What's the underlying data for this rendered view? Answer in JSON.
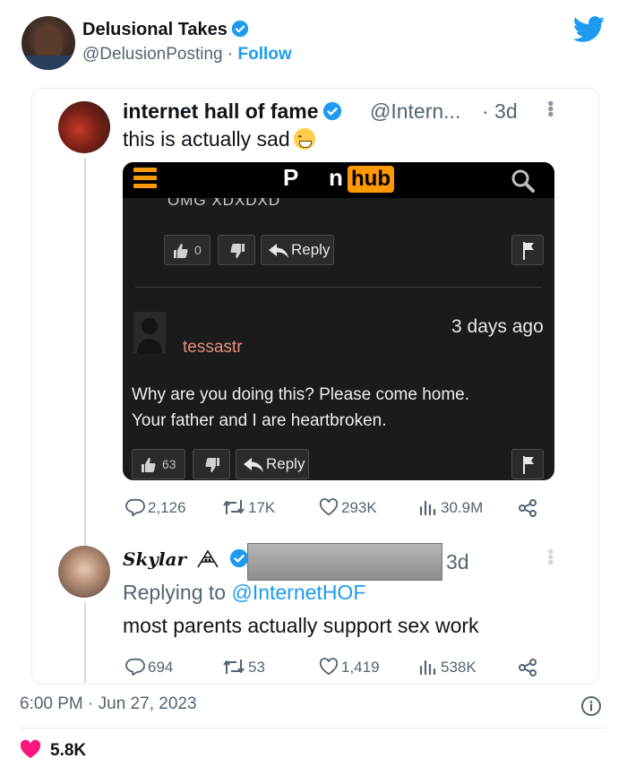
{
  "outer": {
    "name": "Delusional Takes",
    "handle": "@DelusionPosting",
    "separator": "·",
    "follow_label": "Follow"
  },
  "quoted": {
    "name": "internet hall of fame",
    "handle": "@Intern...",
    "time": "· 3d",
    "text": "this is actually sad",
    "screenshot": {
      "logo_left": "P",
      "logo_n": "n",
      "logo_hub": "hub",
      "truncated_text": "OMG XDXDXD",
      "vote_up_count_1": "0",
      "reply_label_1": "Reply",
      "commenter": "tessastr",
      "time_ago": "3 days ago",
      "comment_line_1": "Why are you doing this? Please come home.",
      "comment_line_2": "Your father and I are heartbroken.",
      "vote_up_count_2": "63",
      "reply_label_2": "Reply"
    },
    "metrics": {
      "replies": "2,126",
      "retweets": "17K",
      "likes": "293K",
      "views": "30.9M"
    }
  },
  "reply": {
    "name": "Skylar",
    "time": "3d",
    "replying_prefix": "Replying to",
    "replying_mention": "@InternetHOF",
    "text": "most parents actually support sex work",
    "metrics": {
      "replies": "694",
      "retweets": "53",
      "likes": "1,419",
      "views": "538K"
    }
  },
  "footer": {
    "timestamp": "6:00 PM · Jun 27, 2023",
    "likes": "5.8K"
  },
  "colors": {
    "accent": "#1d9bf0",
    "muted": "#536471",
    "brand_orange": "#ff9900",
    "like_red": "#f91880"
  }
}
